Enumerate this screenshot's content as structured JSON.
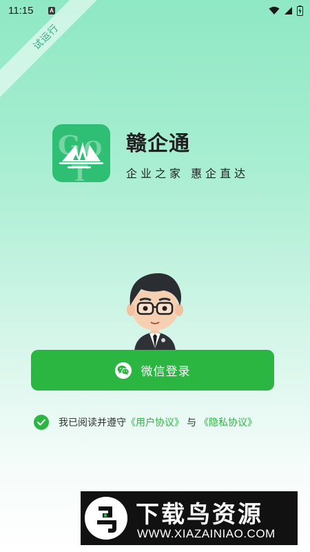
{
  "status_bar": {
    "time": "11:15",
    "notification_glyph": "A",
    "icons": [
      "wifi-icon",
      "signal-icon",
      "battery-icon"
    ]
  },
  "ribbon": {
    "label": "试运行"
  },
  "app": {
    "name": "赣企通",
    "slogan": "企业之家 惠企直达",
    "logo_icon": "app-logo-icon"
  },
  "login": {
    "wechat_button_label": "微信登录",
    "icon": "wechat-icon"
  },
  "agreement": {
    "checked": true,
    "prefix": "我已阅读并遵守",
    "user_agreement": "《用户协议》",
    "separator": "与",
    "privacy_policy": "《隐私协议》"
  },
  "watermark": {
    "title": "下载鸟资源",
    "url": "WWW.XIAZAINIAO.COM"
  },
  "colors": {
    "accent": "#2bb541",
    "background_top": "#8fe8c4",
    "background_bottom": "#ffffff",
    "logo_bg": "#2fbf74"
  }
}
